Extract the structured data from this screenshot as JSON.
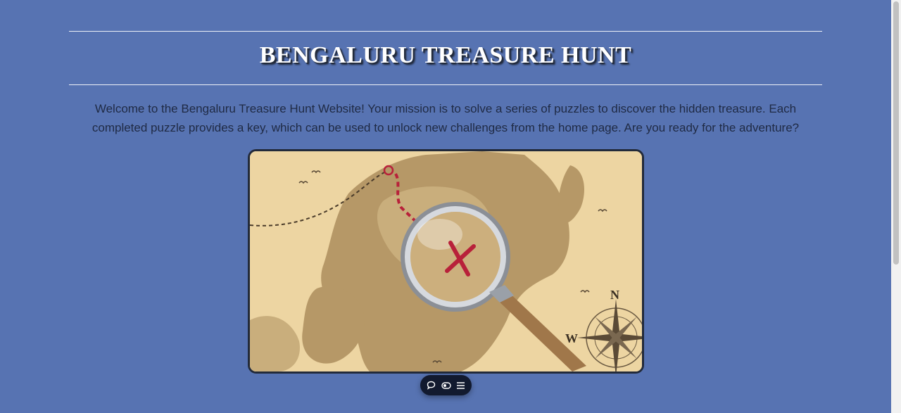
{
  "header": {
    "title": "BENGALURU TREASURE HUNT"
  },
  "intro": {
    "text": "Welcome to the Bengaluru Treasure Hunt Website! Your mission is to solve a series of puzzles to discover the hidden treasure. Each completed puzzle provides a key, which can be used to unlock new challenges from the home page. Are you ready for the adventure?"
  },
  "map_image": {
    "compass_north": "N",
    "compass_west": "W",
    "icon": "treasure-map-magnifier"
  },
  "toolbar": {
    "icons": [
      "comment-icon",
      "toggle-icon",
      "menu-icon"
    ]
  },
  "colors": {
    "background": "#5773b2",
    "frame_border": "#222a3a",
    "toolbar_bg": "#121a2f",
    "route_red": "#b8213a"
  }
}
